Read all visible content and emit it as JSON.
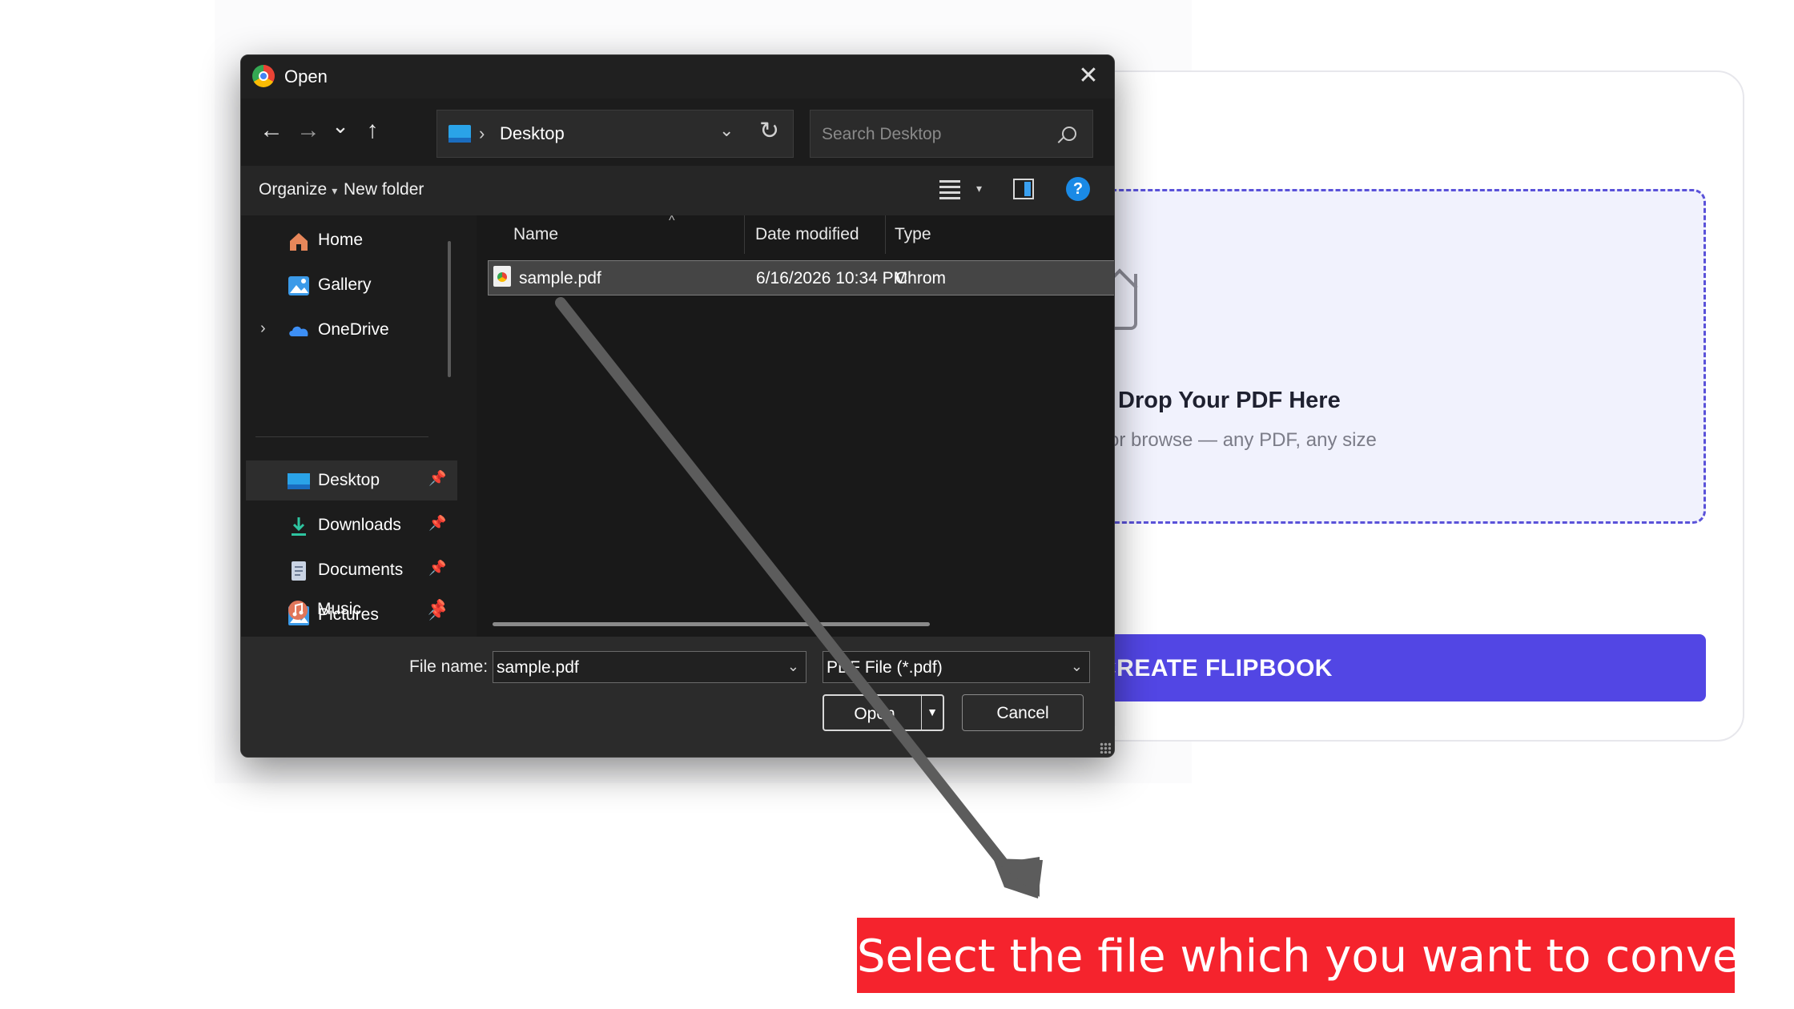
{
  "dialog": {
    "title": "Open",
    "close_label": "✕",
    "nav": {
      "back": "←",
      "forward": "→",
      "recent": "⌄",
      "up": "↑"
    },
    "address": {
      "separator": "›",
      "location": "Desktop",
      "refresh": "↻",
      "chevron": "⌄"
    },
    "search": {
      "placeholder": "Search Desktop"
    },
    "toolbar": {
      "organize": "Organize",
      "new_folder": "New folder",
      "help": "?"
    },
    "sidebar": {
      "items": [
        {
          "label": "Home",
          "icon": "home-icon"
        },
        {
          "label": "Gallery",
          "icon": "gallery-icon"
        },
        {
          "label": "OneDrive",
          "icon": "onedrive-icon",
          "expand": "›"
        },
        {
          "label": "Desktop",
          "icon": "desktop-icon",
          "pinned": true
        },
        {
          "label": "Downloads",
          "icon": "downloads-icon",
          "pinned": true
        },
        {
          "label": "Documents",
          "icon": "documents-icon",
          "pinned": true
        },
        {
          "label": "Pictures",
          "icon": "pictures-icon",
          "pinned": true
        },
        {
          "label": "Music",
          "icon": "music-icon",
          "pinned": true
        }
      ],
      "pin_glyph": "📌"
    },
    "columns": {
      "name": "Name",
      "date": "Date modified",
      "type": "Type",
      "sort": "^"
    },
    "files": [
      {
        "name": "sample.pdf",
        "date": "6/16/2026 10:34 PM",
        "type": "Chrom"
      }
    ],
    "bottom": {
      "file_name_label": "File name:",
      "file_name_value": "sample.pdf",
      "file_type_value": "PDF File (*.pdf)",
      "open_label": "Open",
      "cancel_label": "Cancel"
    }
  },
  "background_page": {
    "drop_title": "Drop Your PDF Here",
    "drop_subtitle": "or browse — any PDF, any size",
    "button_label": "CREATE FLIPBOOK"
  },
  "caption": "Select the file which you want to convert",
  "colors": {
    "accent_button": "#5246e4",
    "dropzone_border": "#5a52d9",
    "caption_bg": "#f5232d",
    "arrow": "#5c5c5c"
  }
}
